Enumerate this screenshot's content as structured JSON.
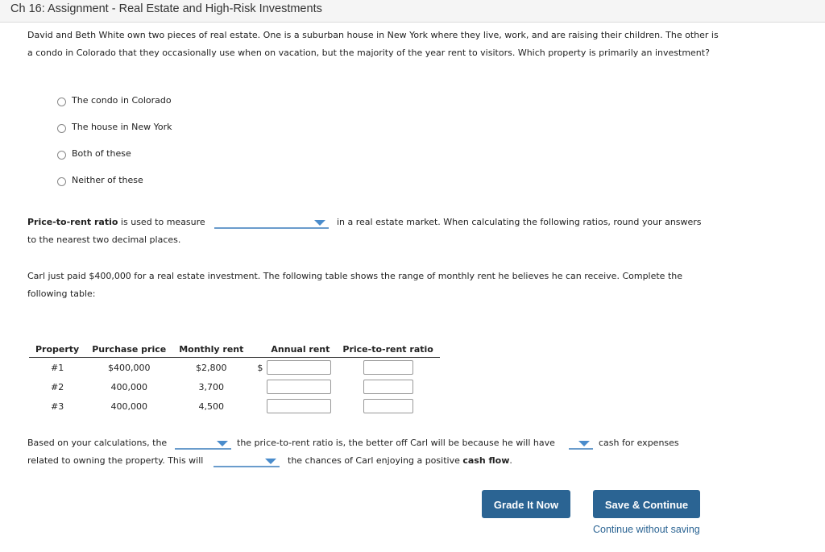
{
  "header": {
    "title": "Ch 16: Assignment - Real Estate and High-Risk Investments"
  },
  "question1": {
    "text": "David and Beth White own two pieces of real estate. One is a suburban house in New York where they live, work, and are raising their children. The other is a condo in Colorado that they occasionally use when on vacation, but the majority of the year rent to visitors. Which property is primarily an investment?",
    "options": [
      {
        "label": "The condo in Colorado",
        "selected": false
      },
      {
        "label": "The house in New York",
        "selected": false
      },
      {
        "label": "Both of these",
        "selected": false
      },
      {
        "label": "Neither of these",
        "selected": false
      }
    ]
  },
  "question2": {
    "bold_term": "Price-to-rent ratio",
    "text_before": " is used to measure",
    "dropdown_value": "",
    "text_after": "in a real estate market. When calculating the following ratios, round your answers",
    "line2": "to the nearest two decimal places."
  },
  "question3": {
    "intro": "Carl just paid $400,000 for a real estate investment. The following table shows the range of monthly rent he believes he can receive. Complete the following table:",
    "table": {
      "headers": [
        "Property",
        "Purchase price",
        "Monthly rent",
        "Annual rent",
        "Price-to-rent ratio"
      ],
      "currency_symbol": "$",
      "rows": [
        {
          "property": "#1",
          "price": "$400,000",
          "monthly": "$2,800",
          "annual": "",
          "ratio": ""
        },
        {
          "property": "#2",
          "price": "400,000",
          "monthly": "3,700",
          "annual": "",
          "ratio": ""
        },
        {
          "property": "#3",
          "price": "400,000",
          "monthly": "4,500",
          "annual": "",
          "ratio": ""
        }
      ]
    }
  },
  "question4": {
    "part1": "Based on your calculations, the",
    "dropdown1": "",
    "part2": "the price-to-rent ratio is, the better off Carl will be because he will have",
    "dropdown2": "",
    "part3": "cash for expenses",
    "part4": "related to owning the property. This will",
    "dropdown3": "",
    "part5": "the chances of Carl enjoying a positive ",
    "bold_term": "cash flow",
    "period": "."
  },
  "actions": {
    "grade_label": "Grade It Now",
    "save_label": "Save & Continue",
    "continue_label": "Continue without saving"
  },
  "colors": {
    "button": "#2b6493",
    "dropdown_line": "#6a9ccc",
    "caret": "#4a8ccc"
  }
}
